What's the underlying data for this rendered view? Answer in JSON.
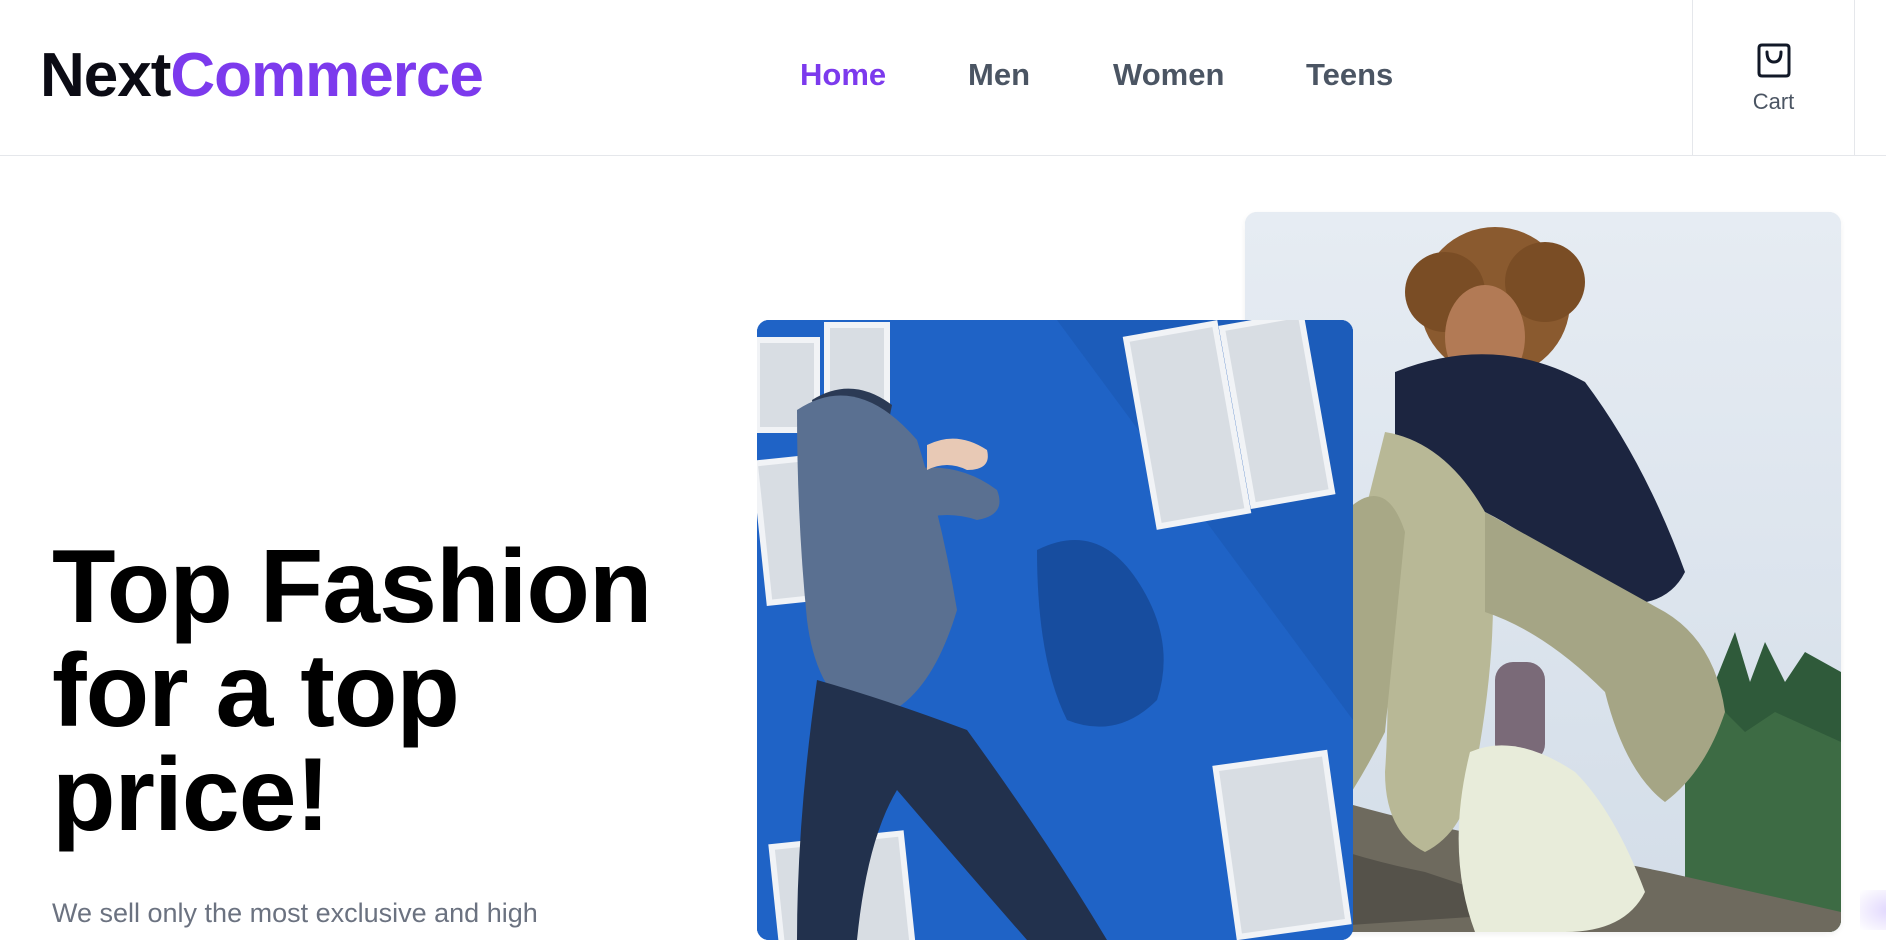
{
  "header": {
    "logo": {
      "part_a": "Next",
      "part_b": "Commerce"
    },
    "nav": [
      {
        "label": "Home",
        "active": true
      },
      {
        "label": "Men",
        "active": false
      },
      {
        "label": "Women",
        "active": false
      },
      {
        "label": "Teens",
        "active": false
      }
    ],
    "cart": {
      "label": "Cart",
      "icon": "shopping-bag-icon"
    }
  },
  "hero": {
    "title": "Top Fashion for a top price!",
    "subtitle": "We sell only the most exclusive and high"
  },
  "images": [
    {
      "name": "hero-photo-woman-sitting",
      "description_icon": "photo"
    },
    {
      "name": "hero-photo-man-jumping",
      "description_icon": "photo"
    }
  ],
  "colors": {
    "brand": "#7c3aed",
    "text_dark": "#0b0b14",
    "nav_text": "#4b5563",
    "muted_text": "#6b7280",
    "divider": "#e5e7eb"
  }
}
